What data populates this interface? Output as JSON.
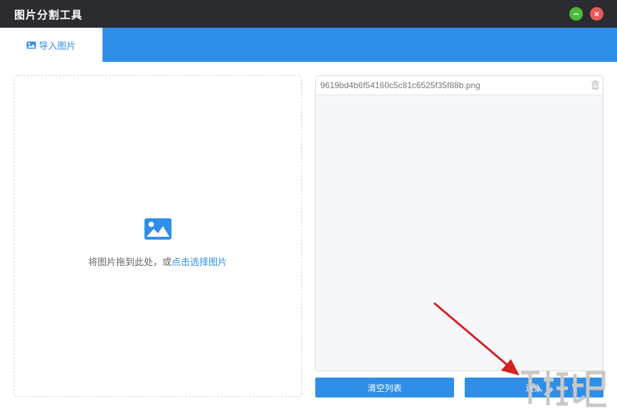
{
  "window": {
    "title": "图片分割工具",
    "minimize_icon": "minimize-icon",
    "close_icon": "close-icon",
    "min_color": "#4cbb3c",
    "close_color": "#ea5a5a"
  },
  "tabs": [
    {
      "label": "导入图片",
      "icon": "image-icon",
      "active": true
    }
  ],
  "dropzone": {
    "icon": "image-icon",
    "hint_text": "将图片拖到此处，或",
    "hint_link": "点击选择图片"
  },
  "file_list": {
    "items": [
      {
        "name": "9619bd4b6f54160c5c81c6525f35f88b.png",
        "action_icon": "trash-icon"
      }
    ]
  },
  "actions": {
    "clear_label": "清空列表",
    "enter_label": "进入"
  },
  "colors": {
    "accent": "#2f8fe8",
    "titlebar": "#2b2c30",
    "annotation_arrow": "#d42020"
  }
}
